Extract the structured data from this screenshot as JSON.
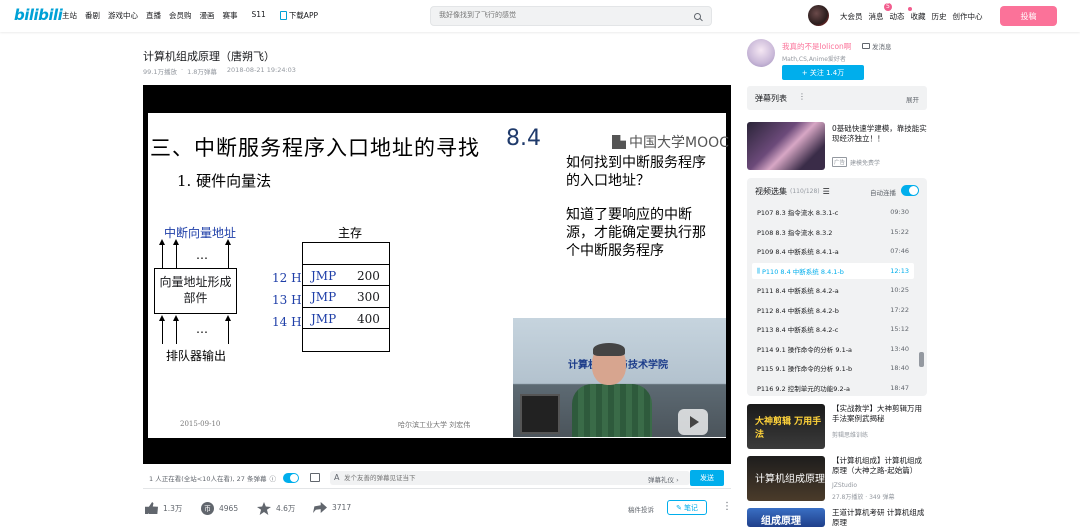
{
  "topnav": {
    "logo": "bilibili",
    "items": [
      "主站",
      "番剧",
      "游戏中心",
      "直播",
      "会员购",
      "漫画",
      "赛事",
      "S11"
    ],
    "download": "下载APP",
    "search_placeholder": "我好像找到了飞行的感觉",
    "right": [
      "大会员",
      "消息",
      "动态",
      "收藏",
      "历史",
      "创作中心"
    ],
    "message_badge": "5",
    "upload": "投稿"
  },
  "video": {
    "title": "计算机组成原理（唐朔飞）",
    "plays": "99.1万播放",
    "danmaku_count": "1.8万弹幕",
    "date": "2018-08-21 19:24:03"
  },
  "slide": {
    "title": "三、中断服务程序入口地址的寻找",
    "number": "8.4",
    "brand": "中国大学MOOC",
    "subtitle": "1.  硬件向量法",
    "question1": "如何找到中断服务程序的入口地址？",
    "question2": "知道了要响应的中断源，才能确定要执行那个中断服务程序",
    "vector_addr": "中断向量地址",
    "memory": "主存",
    "vec_box": "向量地址形成部件",
    "dots": "…",
    "queue": "排队器输出",
    "rows": [
      {
        "addr": "12 H",
        "op": "JMP",
        "val": "200"
      },
      {
        "addr": "13 H",
        "op": "JMP",
        "val": "300"
      },
      {
        "addr": "14 H",
        "op": "JMP",
        "val": "400"
      }
    ],
    "footer_date": "2015-09-10",
    "footer_school": "哈尔滨工业大学   刘宏伟",
    "cam_text": "计算机科学与技术学院"
  },
  "danmaku_bar": {
    "watching": "1 人正在看(全站<10人在看), 27 条弹幕",
    "input_placeholder": "发个友善的弹幕见证当下",
    "etiquette": "弹幕礼仪 ›",
    "send": "发送"
  },
  "actions": {
    "like": "1.3万",
    "coin": "4965",
    "fav": "4.6万",
    "share": "3717",
    "report": "稿件投诉",
    "note": "笔记"
  },
  "uploader": {
    "name": "我真的不是lolicon啊",
    "message": "发消息",
    "desc": "Math,CS,Anime爱好者",
    "follow": "+ 关注 1.4万"
  },
  "danmaku_list": {
    "title": "弹幕列表",
    "more": "⋮",
    "expand": "展开"
  },
  "ad": {
    "title": "0基础快速学建模，靠技能实现经济独立！！",
    "tag_box": "广告",
    "tag": "建模免费学"
  },
  "episodes": {
    "title": "视频选集",
    "count": "(110/128)",
    "autoplay": "自动连播",
    "items": [
      {
        "label": "P107  8.3 指令流水 8.3.1-c",
        "dur": "09:30"
      },
      {
        "label": "P108  8.3 指令流水 8.3.2",
        "dur": "15:22"
      },
      {
        "label": "P109  8.4 中断系统 8.4.1-a",
        "dur": "07:46"
      },
      {
        "label": "P110  8.4 中断系统 8.4.1-b",
        "dur": "12:13"
      },
      {
        "label": "P111  8.4 中断系统 8.4.2-a",
        "dur": "10:25"
      },
      {
        "label": "P112  8.4 中断系统 8.4.2-b",
        "dur": "17:22"
      },
      {
        "label": "P113  8.4 中断系统 8.4.2-c",
        "dur": "15:12"
      },
      {
        "label": "P114  9.1 操作命令的分析 9.1-a",
        "dur": "13:40"
      },
      {
        "label": "P115  9.1 操作命令的分析 9.1-b",
        "dur": "18:40"
      },
      {
        "label": "P116  9.2 控制单元的功能9.2-a",
        "dur": "18:47"
      }
    ]
  },
  "recommendations": [
    {
      "title": "【实战教学】大神剪辑万用手法案例武揭秘",
      "meta": "剪辑思维训练",
      "thumb_text": "大神剪辑 万用手法"
    },
    {
      "title": "【计算机组成】计算机组成原理（大神之路-起始篇）",
      "meta": "JZStudio",
      "meta2": "27.8万播放 · 349 弹幕",
      "thumb_text": "计算机组成原理"
    },
    {
      "title": "王道计算机考研 计算机组成原理",
      "meta": "",
      "thumb_text": "组成原理"
    }
  ]
}
